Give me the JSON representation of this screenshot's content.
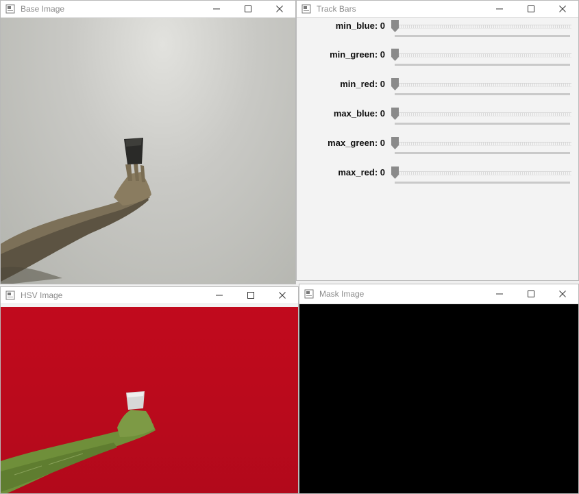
{
  "windows": {
    "base": {
      "title": "Base Image"
    },
    "trackbars": {
      "title": "Track Bars"
    },
    "hsv": {
      "title": "HSV Image"
    },
    "mask": {
      "title": "Mask Image"
    }
  },
  "trackbars": [
    {
      "name": "min_blue: 0",
      "value": 0,
      "max": 255
    },
    {
      "name": "min_green: 0",
      "value": 0,
      "max": 255
    },
    {
      "name": "min_red: 0",
      "value": 0,
      "max": 255
    },
    {
      "name": "max_blue: 0",
      "value": 0,
      "max": 255
    },
    {
      "name": "max_green: 0",
      "value": 0,
      "max": 255
    },
    {
      "name": "max_red: 0",
      "value": 0,
      "max": 255
    }
  ],
  "icons": {
    "app": "app-window-icon",
    "minimize": "minimize-icon",
    "maximize": "maximize-icon",
    "close": "close-icon"
  },
  "colors": {
    "hsv_background": "#bc0a1c",
    "hsv_arm": "#6f8f3a",
    "mask_background": "#000000",
    "thumb": "#8a8a8a"
  }
}
